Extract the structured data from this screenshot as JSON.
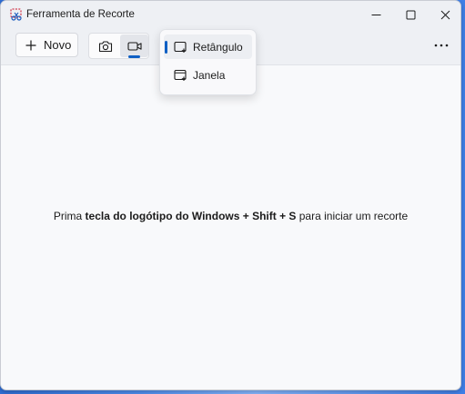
{
  "window": {
    "title": "Ferramenta de Recorte",
    "app_icon": "snipping-tool-icon",
    "caption_buttons": [
      "minimize-icon",
      "maximize-icon",
      "close-icon"
    ]
  },
  "toolbar": {
    "new_label": "Novo",
    "new_icon": "plus-icon",
    "modes": [
      {
        "icon": "camera-icon",
        "selected": false
      },
      {
        "icon": "video-camera-icon",
        "selected": true
      }
    ],
    "more_icon": "more-horizontal-icon",
    "accent_color": "#0f5fc4"
  },
  "capture_area_menu": {
    "items": [
      {
        "label": "Retângulo",
        "icon": "rectangle-capture-icon",
        "selected": true
      },
      {
        "label": "Janela",
        "icon": "window-capture-icon",
        "selected": false
      }
    ]
  },
  "hint": {
    "prefix": "Prima ",
    "keys": "tecla do logótipo do Windows + Shift + S",
    "suffix": " para iniciar um recorte"
  }
}
